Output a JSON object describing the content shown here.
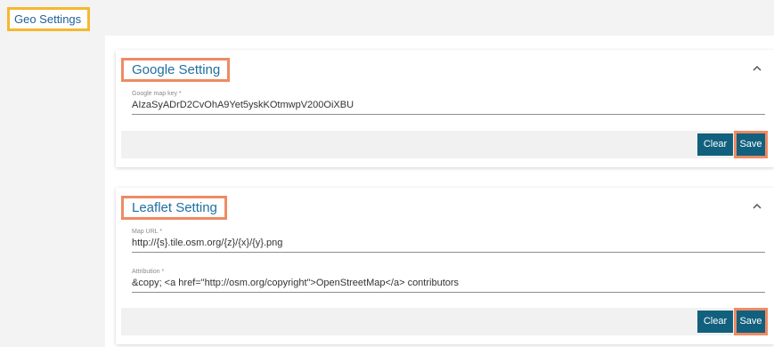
{
  "page": {
    "title": "Geo Settings"
  },
  "google": {
    "title": "Google Setting",
    "collapse_icon": "chevron-up-icon",
    "map_key": {
      "label": "Google map key *",
      "value": "AIzaSyADrD2CvOhA9Yet5yskKOtmwpV200OiXBU"
    },
    "clear_label": "Clear",
    "save_label": "Save"
  },
  "leaflet": {
    "title": "Leaflet Setting",
    "collapse_icon": "chevron-up-icon",
    "map_url": {
      "label": "Map URL *",
      "value": "http://{s}.tile.osm.org/{z}/{x}/{y}.png"
    },
    "attribution": {
      "label": "Attribution *",
      "value": "&copy; <a href=\"http://osm.org/copyright\">OpenStreetMap</a> contributors"
    },
    "clear_label": "Clear",
    "save_label": "Save"
  },
  "colors": {
    "button": "#11607e",
    "highlight_orange": "#ef8a63",
    "highlight_yellow": "#f5b82e",
    "title_blue": "#1f6fa1"
  }
}
